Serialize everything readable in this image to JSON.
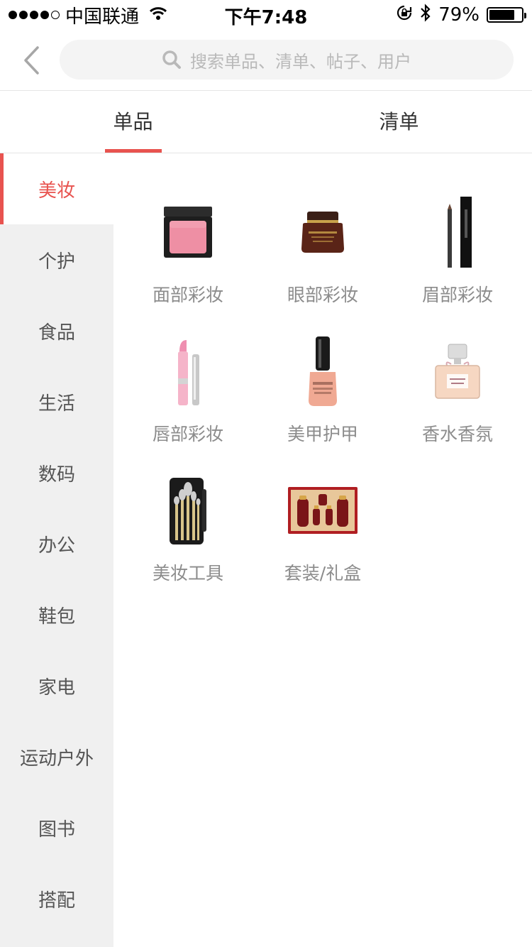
{
  "status_bar": {
    "carrier": "中国联通",
    "time": "下午7:48",
    "battery": "79%",
    "battery_level": 0.79
  },
  "search": {
    "placeholder": "搜索单品、清单、帖子、用户",
    "back_icon": "chevron-left-icon",
    "search_icon": "search-icon"
  },
  "tabs": [
    {
      "label": "单品",
      "active": true
    },
    {
      "label": "清单",
      "active": false
    }
  ],
  "sidebar": {
    "items": [
      {
        "label": "美妆",
        "active": true
      },
      {
        "label": "个护"
      },
      {
        "label": "食品"
      },
      {
        "label": "生活"
      },
      {
        "label": "数码"
      },
      {
        "label": "办公"
      },
      {
        "label": "鞋包"
      },
      {
        "label": "家电"
      },
      {
        "label": "运动户外"
      },
      {
        "label": "图书"
      },
      {
        "label": "搭配"
      }
    ]
  },
  "categories": [
    {
      "label": "面部彩妆",
      "icon": "blush-compact-icon"
    },
    {
      "label": "眼部彩妆",
      "icon": "eye-cream-jar-icon"
    },
    {
      "label": "眉部彩妆",
      "icon": "brow-pencil-icon"
    },
    {
      "label": "唇部彩妆",
      "icon": "lipstick-icon"
    },
    {
      "label": "美甲护甲",
      "icon": "nail-polish-icon"
    },
    {
      "label": "香水香氛",
      "icon": "perfume-bottle-icon"
    },
    {
      "label": "美妆工具",
      "icon": "brush-set-icon"
    },
    {
      "label": "套装/礼盒",
      "icon": "gift-set-icon"
    }
  ],
  "colors": {
    "accent": "#e8534f",
    "sidebar_bg": "#f0f0f0",
    "label_gray": "#8c8c8c"
  }
}
